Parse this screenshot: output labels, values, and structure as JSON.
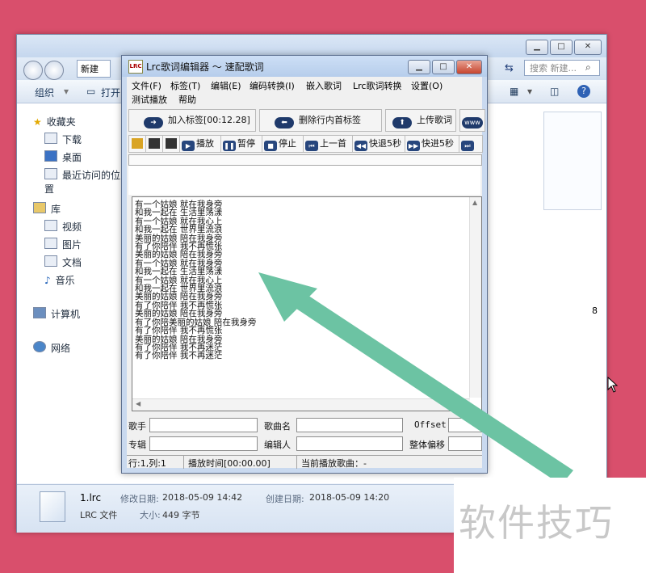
{
  "explorer": {
    "breadcrumb": "新建",
    "search_placeholder": "搜索 新建...",
    "toolbar": {
      "organize": "组织",
      "open": "打开"
    },
    "sidebar": {
      "favorites": "收藏夹",
      "favorites_items": [
        "下载",
        "桌面",
        "最近访问的位置"
      ],
      "library": "库",
      "library_items": [
        "视频",
        "图片",
        "文档",
        "音乐"
      ],
      "computer": "计算机",
      "network": "网络"
    },
    "content_partial_text": "8",
    "details": {
      "filename": "1.lrc",
      "filetype": "LRC 文件",
      "modified_label": "修改日期:",
      "modified_value": "2018-05-09 14:42",
      "created_label": "创建日期:",
      "created_value": "2018-05-09 14:20",
      "size_label": "大小:",
      "size_value": "449 字节"
    }
  },
  "lrc": {
    "title": "Lrc歌词编辑器 ～ 速配歌词",
    "icon_text": "LRC",
    "menu": [
      "文件(F)",
      "标签(T)",
      "编辑(E)",
      "编码转换(I)",
      "嵌入歌词",
      "Lrc歌词转换",
      "设置(O)"
    ],
    "menu2": [
      "测试播放",
      "帮助"
    ],
    "bigbuttons": {
      "add_tag": "加入标签[00:12.28]",
      "delete_tag": "删除行内首标签",
      "upload": "上传歌词",
      "www": "www"
    },
    "controls": {
      "play": "播放",
      "pause": "暂停",
      "stop": "停止",
      "prev": "上一首",
      "rewind": "快退5秒",
      "forward": "快进5秒"
    },
    "lyrics": [
      "有一个姑娘 就在我身旁",
      "和我一起在 生活里荡漾",
      "有一个姑娘 就在我心上",
      "和我一起在 世界里流浪",
      "美丽的姑娘 陪在我身旁",
      "有了你陪伴 我不再慌张",
      "美丽的姑娘 陪在我身旁",
      "有一个姑娘 就在我身旁",
      "和我一起在 生活里荡漾",
      "有一个姑娘 就在我心上",
      "和我一起在 世界里流浪",
      "美丽的姑娘 陪在我身旁",
      "有了你陪伴 我不再慌张",
      "美丽的姑娘 陪在我身旁",
      "有了你陪美丽的姑娘 陪在我身旁",
      "有了你陪伴 我不再慌张",
      "美丽的姑娘 陪在我身旁",
      "有了你陪伴 我不再迷茫",
      "有了你陪伴 我不再迷茫"
    ],
    "fields": {
      "singer": "歌手",
      "song": "歌曲名",
      "offset": "Offset",
      "album": "专辑",
      "editor": "编辑人",
      "total_offset": "整体偏移"
    },
    "status": {
      "position": "行:1,列:1",
      "playtime": "播放时间[00:00.00]",
      "current": "当前播放歌曲：-"
    }
  },
  "watermark": "软件技巧",
  "colors": {
    "background": "#d94f6c",
    "arrow": "#6cc3a3",
    "accent_dark": "#1f3a6b"
  }
}
